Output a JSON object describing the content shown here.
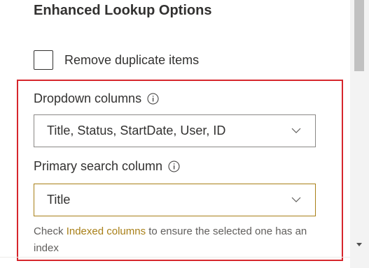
{
  "section": {
    "title": "Enhanced Lookup Options"
  },
  "remove_duplicates": {
    "label": "Remove duplicate items",
    "checked": false
  },
  "dropdown_columns": {
    "label": "Dropdown columns",
    "value": "Title, Status, StartDate, User, ID"
  },
  "primary_search_column": {
    "label": "Primary search column",
    "value": "Title"
  },
  "help": {
    "prefix": "Check ",
    "link": "Indexed columns",
    "suffix": " to ensure the selected one has an index"
  },
  "icons": {
    "info": "info-icon",
    "chevron": "chevron-down-icon",
    "scroll_down": "scroll-down-arrow-icon"
  },
  "colors": {
    "highlight_border": "#d6262c",
    "accent": "#a87f17",
    "text": "#323130"
  }
}
